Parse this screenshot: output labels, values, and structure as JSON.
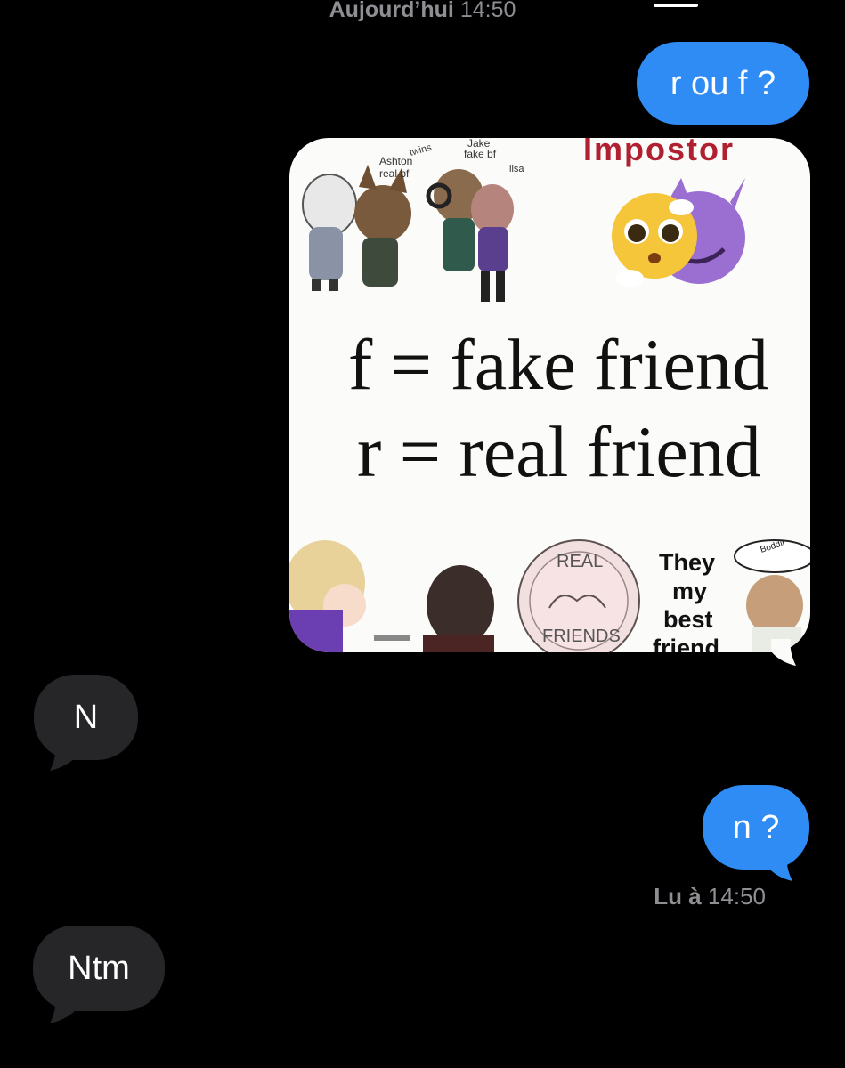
{
  "header": {
    "day": "Aujourd’hui",
    "time": "14:50"
  },
  "messages": {
    "m1": {
      "text": "r ou f ?",
      "direction": "outgoing"
    },
    "m2": {
      "type": "image",
      "direction": "outgoing",
      "image_text": {
        "impostor": "Impostor",
        "line_f": "f = fake friend",
        "line_r": "r = real friend",
        "ashton": "Ashton",
        "real_bf": "real bf",
        "twins": "twins",
        "jake": "Jake",
        "fake_bf": "fake bf",
        "lisa": "lisa",
        "real": "REAL",
        "friends": "FRIENDS",
        "they": "They",
        "my": "my",
        "best": "best",
        "friend": "friend",
        "hat": "Boddir"
      }
    },
    "m3": {
      "text": "N",
      "direction": "incoming"
    },
    "m4": {
      "text": "n ?",
      "direction": "outgoing"
    },
    "m5": {
      "text": "Ntm",
      "direction": "incoming"
    }
  },
  "read_receipt": {
    "label": "Lu à",
    "time": "14:50"
  },
  "colors": {
    "background": "#000000",
    "outgoing_bubble": "#2f8cf5",
    "incoming_bubble": "#262628",
    "meta_text": "#8e8e93"
  }
}
